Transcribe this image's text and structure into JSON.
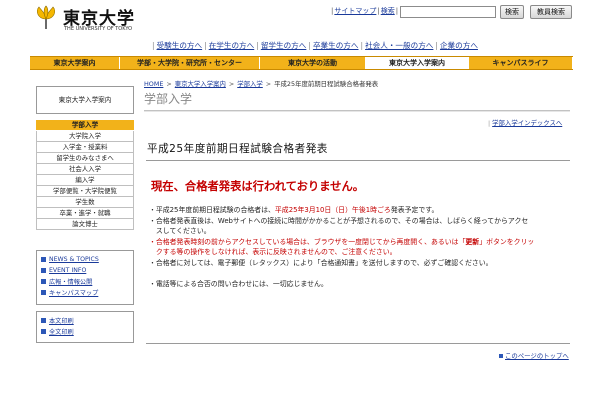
{
  "header": {
    "logo_title": "東京大学",
    "logo_sub": "THE UNIVERSITY OF TOKYO",
    "util_links": [
      "サイトマップ",
      "検索"
    ],
    "search_button": "検索",
    "faculty_search_button": "教員検索"
  },
  "audience_links": [
    "受験生の方へ",
    "在学生の方へ",
    "留学生の方へ",
    "卒業生の方へ",
    "社会人・一般の方へ",
    "企業の方へ"
  ],
  "main_nav": [
    {
      "label": "東京大学案内",
      "active": false
    },
    {
      "label": "学部・大学院・研究所・センター",
      "active": false
    },
    {
      "label": "東京大学の活動",
      "active": false
    },
    {
      "label": "東京大学入学案内",
      "active": true
    },
    {
      "label": "キャンパスライフ",
      "active": false
    }
  ],
  "sidebar": {
    "title": "東京大学入学案内",
    "heading": "学部入学",
    "items": [
      "大学院入学",
      "入学金・授業料",
      "留学生のみなさまへ",
      "社会人入学",
      "編入学",
      "学部便覧・大学院便覧",
      "学生数",
      "卒業・進学・就職",
      "論文博士"
    ],
    "box1": [
      "NEWS & TOPICS",
      "EVENT INFO",
      "広報・情報公開",
      "キャンパスマップ"
    ],
    "box2": [
      "本文印刷",
      "全文印刷"
    ]
  },
  "breadcrumb": [
    "HOME",
    "東京大学入学案内",
    "学部入学",
    "平成25年度前期日程試験合格者発表"
  ],
  "section_title": "学部入学",
  "index_link": "学部入学インデックスへ",
  "page_title": "平成25年度前期日程試験合格者発表",
  "notice": "現在、合格者発表は行われておりません。",
  "body": {
    "l1a": "・平成25年度前期日程試験の合格者は、",
    "l1b": "平成25年3月10日（日）午後1時ごろ",
    "l1c": "発表予定です。",
    "l2": "・合格者発表直後は、Webサイトへの接続に時間がかかることが予想されるので、その場合は、しばらく経ってからアクセ",
    "l3": "　スしてください。",
    "l4a": "・合格者発表時刻の前からアクセスしている場合は、ブラウザを一度閉じてから再度開く、あるいは「",
    "l4b": "更新",
    "l4c": "」ボタンをクリッ",
    "l5": "　クする等の操作をしなければ、表示に反映されませんので、ご注意ください。",
    "l6": "・合格者に対しては、電子郵便（レタックス）により「合格通知書」を送付しますので、必ずご確認ください。",
    "l7": "・電話等による合否の問い合わせには、一切応じません。"
  },
  "page_top": "このページのトップへ"
}
